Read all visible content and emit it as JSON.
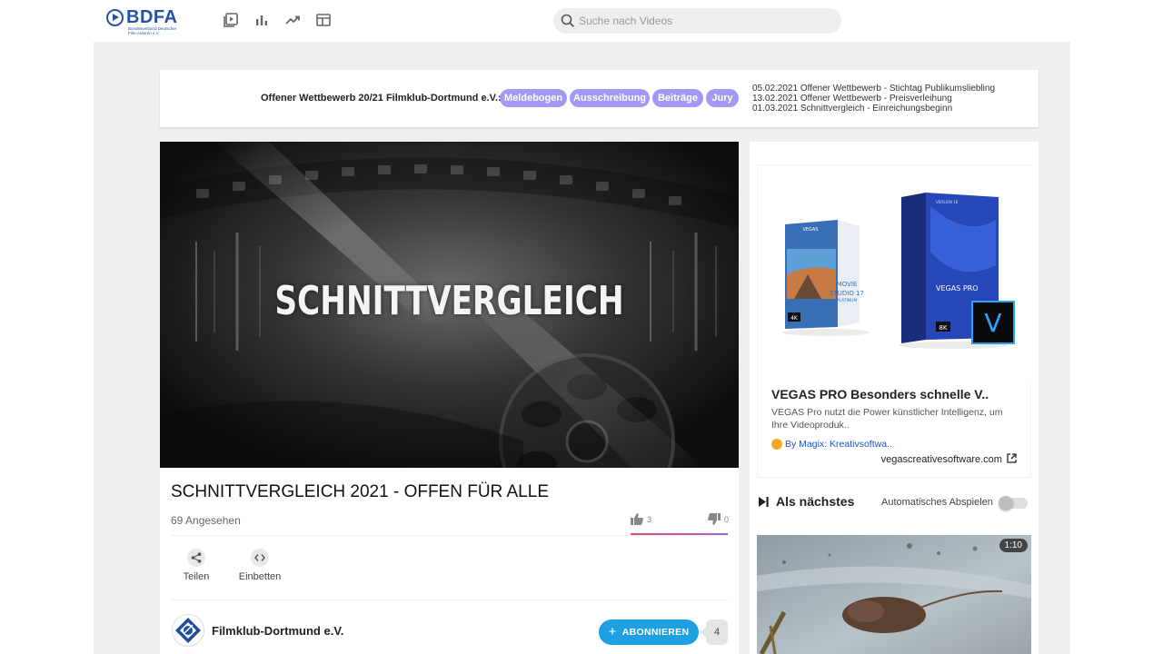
{
  "header": {
    "logo_text": "BDFA",
    "logo_subtitle": "Bundesverband Deutscher Film-Autoren e.V.",
    "nav_icons": [
      "video-library-icon",
      "bar-chart-icon",
      "trending-icon",
      "browse-icon"
    ],
    "search_placeholder": "Suche nach Videos"
  },
  "announcement": {
    "title": "Offener Wettbewerb 20/21 Filmklub-Dortmund e.V.:",
    "pills": [
      "Meldebogen",
      "Ausschreibung",
      "Beiträge",
      "Jury"
    ],
    "pill_color": "#a29af2",
    "dates": [
      "05.02.2021 Offener Wettbewerb - Stichtag Publikumsliebling",
      "13.02.2021 Offener Wettbewerb - Preisverleihung",
      "01.03.2021 Schnittvergleich - Einreichungsbeginn"
    ]
  },
  "video": {
    "overlay_text": "SCHNITTVERGLEICH",
    "title": "SCHNITTVERGLEICH 2021 - OFFEN FÜR ALLE",
    "views": "69 Angesehen",
    "likes": "3",
    "dislikes": "0",
    "actions": {
      "share": "Teilen",
      "embed": "Einbetten"
    },
    "channel": "Filmklub-Dortmund e.V.",
    "subscribe_label": "ABONNIEREN",
    "subscriber_count": "4",
    "accent_color": "#1da1e2"
  },
  "ad": {
    "title": "VEGAS PRO Besonders schnelle V..",
    "description": "VEGAS Pro nutzt die Power künstlicher Intelligenz, um Ihre Videoproduk..",
    "by": "By Magix: Kreativsoftwa..",
    "domain": "vegascreativesoftware.com",
    "box_left": {
      "brand": "VEGAS",
      "line1": "MOVIE",
      "line2": "STUDIO 17",
      "line3": "PLATINUM",
      "badge": "4K"
    },
    "box_right": {
      "version": "VERSION 18",
      "brand": "VEGAS PRO",
      "badge": "8K",
      "logo_letter": "V"
    }
  },
  "up_next": {
    "label": "Als nächstes",
    "autoplay_label": "Automatisches Abspielen",
    "autoplay_on": false,
    "first_duration": "1:10"
  }
}
